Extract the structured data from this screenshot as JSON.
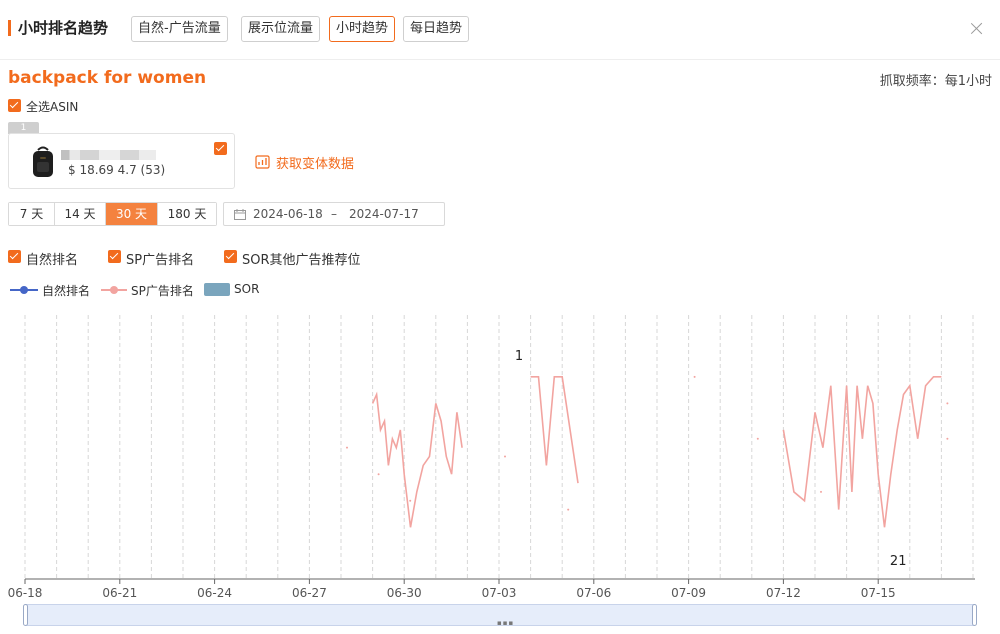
{
  "header": {
    "title": "小时排名趋势",
    "tabs": [
      "自然-广告流量",
      "展示位流量",
      "小时趋势",
      "每日趋势"
    ],
    "active_tab": "小时趋势"
  },
  "keyword": "backpack for women",
  "frequency": "抓取频率：每1小时",
  "select_all_label": "全选ASIN",
  "asin_card": {
    "index_badge": "1",
    "price_rating": "$ 18.69 4.7 (53)"
  },
  "variant_link": "获取变体数据",
  "date_ranges": [
    "7 天",
    "14 天",
    "30 天",
    "180 天"
  ],
  "active_range": "30 天",
  "date_range": {
    "start": "2024-06-18",
    "separator": "–",
    "end": "2024-07-17"
  },
  "filters": [
    "自然排名",
    "SP广告排名",
    "SOR其他广告推荐位"
  ],
  "colors": {
    "accent": "#f26b1d",
    "organic": "#4566c7",
    "sp": "#f2a4a0",
    "sor": "#7aa5bd"
  },
  "chart_data": {
    "type": "line",
    "x_tick_labels": [
      "06-18",
      "06-21",
      "06-24",
      "06-27",
      "06-30",
      "07-03",
      "07-06",
      "07-09",
      "07-12",
      "07-15"
    ],
    "legend": [
      {
        "name": "自然排名",
        "style": "line",
        "color": "#4566c7"
      },
      {
        "name": "SP广告排名",
        "style": "line",
        "color": "#f2a4a0"
      },
      {
        "name": "SOR",
        "style": "area",
        "color": "#7aa5bd"
      }
    ],
    "legend_position": "top-left",
    "y_axis": "inverted rank, hidden",
    "ylim": [
      21,
      1
    ],
    "grid": "vertical dashed lines",
    "annotations": [
      {
        "label": "1",
        "x": "07-03",
        "value": 1
      },
      {
        "label": "21",
        "x": "07-15",
        "value": 21
      }
    ],
    "series": [
      {
        "name": "SP广告排名",
        "points": [
          [
            "06-29",
            5
          ],
          [
            "06-29",
            4
          ],
          [
            "06-29",
            8
          ],
          [
            "06-29",
            7
          ],
          [
            "06-29",
            12
          ],
          [
            "06-29",
            9
          ],
          [
            "06-29",
            10
          ],
          [
            "06-29",
            8
          ],
          [
            "06-30",
            13
          ],
          [
            "06-30",
            19
          ],
          [
            "06-30",
            15
          ],
          [
            "06-30",
            12
          ],
          [
            "06-30",
            11
          ],
          [
            "07-01",
            5
          ],
          [
            "07-01",
            7
          ],
          [
            "07-01",
            11
          ],
          [
            "07-01",
            13
          ],
          [
            "07-01",
            6
          ],
          [
            "07-01",
            10
          ],
          [
            "07-04",
            2
          ],
          [
            "07-04",
            2
          ],
          [
            "07-04",
            12
          ],
          [
            "07-04",
            2
          ],
          [
            "07-05",
            2
          ],
          [
            "07-05",
            14
          ],
          [
            "07-12",
            8
          ],
          [
            "07-12",
            15
          ],
          [
            "07-12",
            16
          ],
          [
            "07-13",
            6
          ],
          [
            "07-13",
            10
          ],
          [
            "07-13",
            3
          ],
          [
            "07-13",
            17
          ],
          [
            "07-14",
            3
          ],
          [
            "07-14",
            15
          ],
          [
            "07-14",
            3
          ],
          [
            "07-14",
            9
          ],
          [
            "07-14",
            3
          ],
          [
            "07-14",
            5
          ],
          [
            "07-15",
            13
          ],
          [
            "07-15",
            19
          ],
          [
            "07-15",
            13
          ],
          [
            "07-15",
            8
          ],
          [
            "07-15",
            4
          ],
          [
            "07-16",
            3
          ],
          [
            "07-16",
            9
          ],
          [
            "07-16",
            3
          ],
          [
            "07-16",
            2
          ],
          [
            "07-17",
            2
          ]
        ]
      }
    ]
  }
}
